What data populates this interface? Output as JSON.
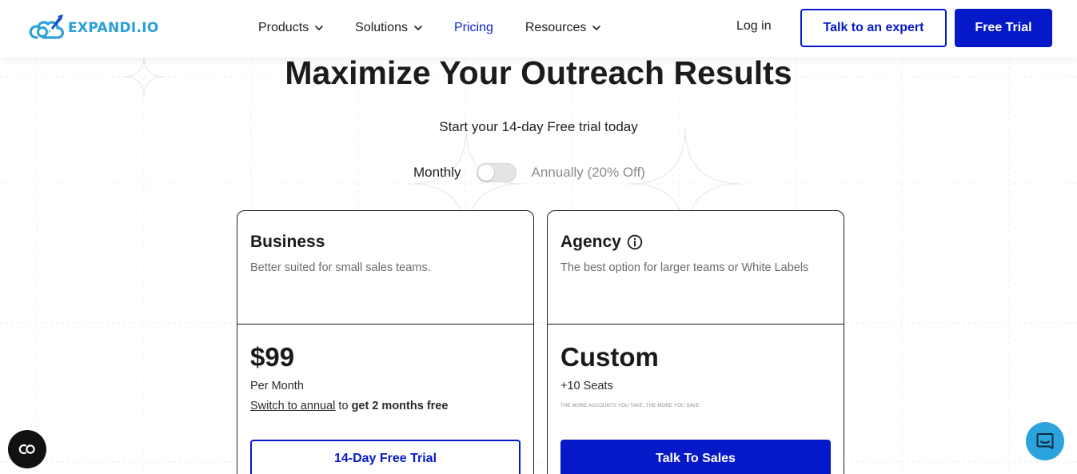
{
  "header": {
    "logo_text": "EXPANDI.IO",
    "nav": [
      {
        "label": "Products",
        "has_dropdown": true,
        "active": false
      },
      {
        "label": "Solutions",
        "has_dropdown": true,
        "active": false
      },
      {
        "label": "Pricing",
        "has_dropdown": false,
        "active": true
      },
      {
        "label": "Resources",
        "has_dropdown": true,
        "active": false
      }
    ],
    "login_label": "Log in",
    "expert_label": "Talk to an expert",
    "trial_label": "Free Trial"
  },
  "hero": {
    "title": "Maximize Your Outreach Results",
    "subtitle": "Start your 14-day Free trial today"
  },
  "billing_toggle": {
    "monthly_label": "Monthly",
    "annual_label": "Annually (20% Off)",
    "selected": "Monthly"
  },
  "plans": [
    {
      "name": "Business",
      "description": "Better suited for small sales teams.",
      "price": "$99",
      "period": "Per Month",
      "switch_link": "Switch to annual",
      "switch_text": " to ",
      "switch_bold": "get 2 months free",
      "cta": "14-Day Free Trial"
    },
    {
      "name": "Agency",
      "description": "The best option for larger teams or White Labels",
      "price": "Custom",
      "period": "+10 Seats",
      "note": "THE MORE ACCOUNTS YOU TAKE, THE MORE YOU SAVE",
      "cta": "Talk To Sales"
    }
  ],
  "colors": {
    "brand_blue": "#0519c9",
    "logo_blue": "#2a9fd8",
    "chat_bubble": "#2ba3dc"
  },
  "icons": {
    "logo": "rocket-cloud-logo-icon",
    "dropdown": "chevron-down-icon",
    "info": "info-icon",
    "cookie": "cookie-consent-icon",
    "chat": "chat-bubble-icon"
  }
}
